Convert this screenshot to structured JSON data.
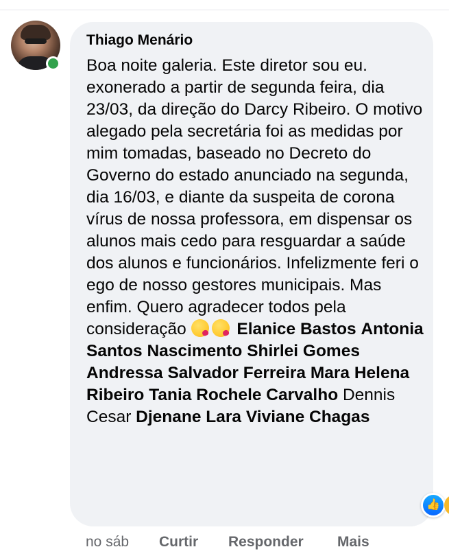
{
  "comment": {
    "author": "Thiago Menário",
    "text": "Boa noite galeria. Este diretor sou eu. exonerado a partir de segunda feira, dia 23/03, da direção do Darcy Ribeiro. O motivo alegado pela secretária foi as medidas por mim tomadas, baseado no Decreto do Governo do estado anunciado na segunda, dia 16/03, e diante da suspeita de corona vírus de nossa professora, em dispensar os alunos mais cedo para resguardar a saúde dos alunos e funcionários. Infelizmente feri o ego de nosso gestores municipais. Mas enfim. Quero agradecer todos pela consideração",
    "emojis": [
      "kissing-heart-emoji",
      "kissing-heart-emoji"
    ],
    "tags": [
      "Elanice Bastos",
      "Antonia Santos Nascimento",
      "Shirlei Gomes",
      "Andressa Salvador Ferreira",
      "Mara Helena Ribeiro",
      "Tania Rochele Carvalho"
    ],
    "plain_name": "Dennis Cesar",
    "tags_after": [
      "Djenane Lara",
      "Viviane Chagas"
    ],
    "online_status_color": "#31a24c",
    "reactions": [
      "like-icon",
      "haha-icon"
    ]
  },
  "actions": {
    "time": "no sáb",
    "like": "Curtir",
    "reply": "Responder",
    "more": "Mais"
  }
}
